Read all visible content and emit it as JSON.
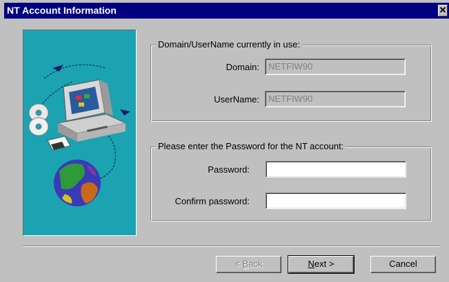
{
  "window": {
    "title": "NT Account Information",
    "close_glyph": "✕"
  },
  "group_current": {
    "legend": "Domain/UserName currently in use:",
    "domain_label": "Domain:",
    "domain_value": "NETFIW90",
    "username_label": "UserName:",
    "username_value": "NETFIW90"
  },
  "group_password": {
    "legend": "Please enter the Password for the NT account:",
    "password_label": "Password:",
    "password_value": "",
    "confirm_label": "Confirm password:",
    "confirm_value": ""
  },
  "buttons": {
    "back": {
      "pre": "< ",
      "mnemonic": "B",
      "post": "ack"
    },
    "next": {
      "pre": "",
      "mnemonic": "N",
      "post": "ext >"
    },
    "cancel": {
      "label": "Cancel"
    }
  },
  "illustration": {
    "icons": [
      "computer-icon",
      "cd-disc-icon",
      "floppy-disk-icon",
      "globe-icon",
      "network-arrow-icon"
    ]
  },
  "colors": {
    "title_bar": "#000080",
    "dialog_face": "#c0c0c0",
    "illustration_bg": "#1ba3b2",
    "disabled_text": "#808080"
  }
}
